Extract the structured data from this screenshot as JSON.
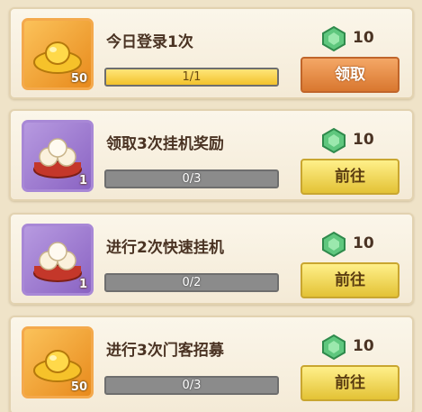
{
  "tasks": [
    {
      "reward_icon": "gold-ingot-icon",
      "reward_count": "50",
      "title": "今日登录1次",
      "progress_text": "1/1",
      "progress_fraction": 1.0,
      "gem_icon": "green-gem-icon",
      "gem_amount": "10",
      "button_label": "领取",
      "button_style": "claim"
    },
    {
      "reward_icon": "steamed-buns-icon",
      "reward_count": "1",
      "title": "领取3次挂机奖励",
      "progress_text": "0/3",
      "progress_fraction": 0.0,
      "gem_icon": "green-gem-icon",
      "gem_amount": "10",
      "button_label": "前往",
      "button_style": "goto"
    },
    {
      "reward_icon": "steamed-buns-icon",
      "reward_count": "1",
      "title": "进行2次快速挂机",
      "progress_text": "0/2",
      "progress_fraction": 0.0,
      "gem_icon": "green-gem-icon",
      "gem_amount": "10",
      "button_label": "前往",
      "button_style": "goto"
    },
    {
      "reward_icon": "gold-ingot-icon",
      "reward_count": "50",
      "title": "进行3次门客招募",
      "progress_text": "0/3",
      "progress_fraction": 0.0,
      "gem_icon": "green-gem-icon",
      "gem_amount": "10",
      "button_label": "前往",
      "button_style": "goto"
    }
  ],
  "colors": {
    "claim_button": "#d9772f",
    "goto_button": "#e3c235",
    "progress_fill": "#f2c22c",
    "gold_frame": "#e88a1c",
    "purple_frame": "#8a63c3"
  }
}
